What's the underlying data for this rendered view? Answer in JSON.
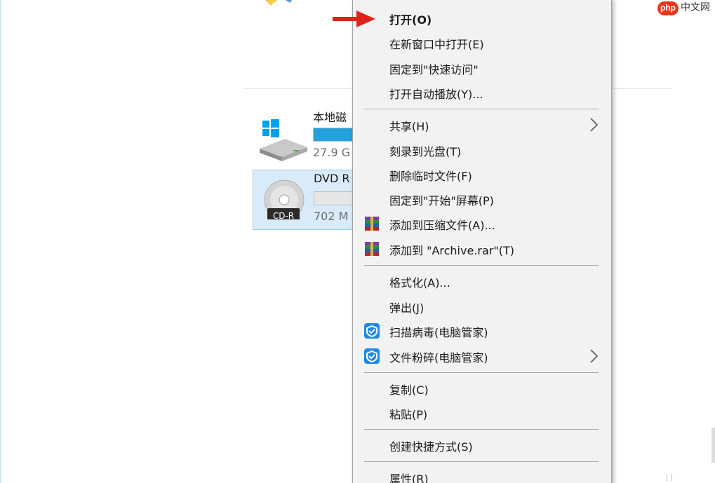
{
  "explorer": {
    "drives": [
      {
        "name": "本地磁",
        "size": "27.9 G",
        "usage": 0.9,
        "icon": "windows-drive-icon"
      },
      {
        "name": "DVD R",
        "size": "702 M",
        "usage": 0.0,
        "icon": "cd-r-disc-icon",
        "badge": "CD-R"
      }
    ]
  },
  "context_menu": {
    "items": [
      {
        "label": "打开(O)",
        "bold": true
      },
      {
        "label": "在新窗口中打开(E)"
      },
      {
        "label": "固定到\"快速访问\""
      },
      {
        "label": "打开自动播放(Y)..."
      },
      {
        "label": "共享(H)",
        "submenu": true
      },
      {
        "label": "刻录到光盘(T)"
      },
      {
        "label": "删除临时文件(F)"
      },
      {
        "label": "固定到\"开始\"屏幕(P)"
      },
      {
        "label": "添加到压缩文件(A)...",
        "icon": "winrar-icon"
      },
      {
        "label": "添加到 \"Archive.rar\"(T)",
        "icon": "winrar-icon"
      },
      {
        "label": "格式化(A)..."
      },
      {
        "label": "弹出(J)"
      },
      {
        "label": "扫描病毒(电脑管家)",
        "icon": "tencent-shield-icon"
      },
      {
        "label": "文件粉碎(电脑管家)",
        "icon": "tencent-shield-icon",
        "submenu": true
      },
      {
        "label": "复制(C)"
      },
      {
        "label": "粘贴(P)"
      },
      {
        "label": "创建快捷方式(S)"
      },
      {
        "label": "属性(R)"
      }
    ]
  },
  "watermark": {
    "logo": "php",
    "text": "中文网"
  },
  "colors": {
    "accent": "#26a0da",
    "arrow": "#e0211a",
    "menu_bg": "#f2f2f2",
    "selection": "#d9ebf8"
  }
}
